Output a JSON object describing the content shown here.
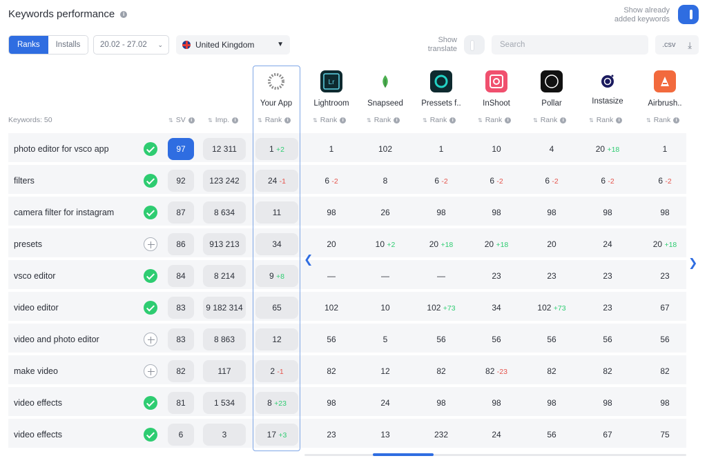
{
  "header": {
    "title": "Keywords performance",
    "show_added_label_1": "Show already",
    "show_added_label_2": "added keywords"
  },
  "toolbar": {
    "tabs": [
      "Ranks",
      "Installs"
    ],
    "active_tab": "Ranks",
    "date_range": "20.02 - 27.02",
    "country": "United Kingdom",
    "show_translate_1": "Show",
    "show_translate_2": "translate",
    "search_placeholder": "Search",
    "csv_label": ".csv"
  },
  "columns": {
    "keywords_label": "Keywords: 50",
    "sv_label": "SV",
    "imp_label": "Imp.",
    "rank_label": "Rank"
  },
  "apps": [
    {
      "name": "Your App",
      "icon": "your-app-icon",
      "color": "#ffffff"
    },
    {
      "name": "Lightroom",
      "icon": "lightroom-icon",
      "color": "#0e2a2f"
    },
    {
      "name": "Snapseed",
      "icon": "snapseed-icon",
      "color": "#ffffff"
    },
    {
      "name": "Pressets f..",
      "icon": "presets-icon",
      "color": "#0e2a2f"
    },
    {
      "name": "InShoot",
      "icon": "inshoot-icon",
      "color": "#f0506e"
    },
    {
      "name": "Pollar",
      "icon": "pollar-icon",
      "color": "#111111"
    },
    {
      "name": "Instasize",
      "icon": "instasize-icon",
      "color": "#ffffff"
    },
    {
      "name": "Airbrush..",
      "icon": "airbrush-icon",
      "color": "#f26a3d"
    }
  ],
  "rows": [
    {
      "keyword": "photo editor for vsco app",
      "added": true,
      "sv": "97",
      "sv_highlight": true,
      "imp": "12 311",
      "ranks": [
        [
          "1",
          "+2"
        ],
        [
          "1",
          ""
        ],
        [
          "102",
          ""
        ],
        [
          "1",
          ""
        ],
        [
          "10",
          ""
        ],
        [
          "4",
          ""
        ],
        [
          "20",
          "+18"
        ],
        [
          "1",
          ""
        ]
      ]
    },
    {
      "keyword": "filters",
      "added": true,
      "sv": "92",
      "imp": "123 242",
      "ranks": [
        [
          "24",
          "-1"
        ],
        [
          "6",
          "-2"
        ],
        [
          "8",
          ""
        ],
        [
          "6",
          "-2"
        ],
        [
          "6",
          "-2"
        ],
        [
          "6",
          "-2"
        ],
        [
          "6",
          "-2"
        ],
        [
          "6",
          "-2"
        ]
      ]
    },
    {
      "keyword": "camera filter for instagram",
      "added": true,
      "sv": "87",
      "imp": "8 634",
      "ranks": [
        [
          "11",
          ""
        ],
        [
          "98",
          ""
        ],
        [
          "26",
          ""
        ],
        [
          "98",
          ""
        ],
        [
          "98",
          ""
        ],
        [
          "98",
          ""
        ],
        [
          "98",
          ""
        ],
        [
          "98",
          ""
        ]
      ]
    },
    {
      "keyword": "presets",
      "added": false,
      "sv": "86",
      "imp": "913 213",
      "ranks": [
        [
          "34",
          ""
        ],
        [
          "20",
          ""
        ],
        [
          "10",
          "+2"
        ],
        [
          "20",
          "+18"
        ],
        [
          "20",
          "+18"
        ],
        [
          "20",
          ""
        ],
        [
          "24",
          ""
        ],
        [
          "20",
          "+18"
        ]
      ]
    },
    {
      "keyword": "vsco editor",
      "added": true,
      "sv": "84",
      "imp": "8 214",
      "ranks": [
        [
          "9",
          "+8"
        ],
        [
          "—",
          ""
        ],
        [
          "—",
          ""
        ],
        [
          "—",
          ""
        ],
        [
          "23",
          ""
        ],
        [
          "23",
          ""
        ],
        [
          "23",
          ""
        ],
        [
          "23",
          ""
        ]
      ]
    },
    {
      "keyword": "video editor",
      "added": true,
      "sv": "83",
      "imp": "9 182 314",
      "ranks": [
        [
          "65",
          ""
        ],
        [
          "102",
          ""
        ],
        [
          "10",
          ""
        ],
        [
          "102",
          "+73"
        ],
        [
          "34",
          ""
        ],
        [
          "102",
          "+73"
        ],
        [
          "23",
          ""
        ],
        [
          "67",
          ""
        ]
      ]
    },
    {
      "keyword": "video and photo editor",
      "added": false,
      "sv": "83",
      "imp": "8 863",
      "ranks": [
        [
          "12",
          ""
        ],
        [
          "56",
          ""
        ],
        [
          "5",
          ""
        ],
        [
          "56",
          ""
        ],
        [
          "56",
          ""
        ],
        [
          "56",
          ""
        ],
        [
          "56",
          ""
        ],
        [
          "56",
          ""
        ]
      ]
    },
    {
      "keyword": "make video",
      "added": false,
      "sv": "82",
      "imp": "117",
      "ranks": [
        [
          "2",
          "-1"
        ],
        [
          "82",
          ""
        ],
        [
          "12",
          ""
        ],
        [
          "82",
          ""
        ],
        [
          "82",
          "-23"
        ],
        [
          "82",
          ""
        ],
        [
          "82",
          ""
        ],
        [
          "82",
          ""
        ]
      ]
    },
    {
      "keyword": "video effects",
      "added": true,
      "sv": "81",
      "imp": "1 534",
      "ranks": [
        [
          "8",
          "+23"
        ],
        [
          "98",
          ""
        ],
        [
          "24",
          ""
        ],
        [
          "98",
          ""
        ],
        [
          "98",
          ""
        ],
        [
          "98",
          ""
        ],
        [
          "98",
          ""
        ],
        [
          "98",
          ""
        ]
      ]
    },
    {
      "keyword": "video effects",
      "added": true,
      "sv": "6",
      "imp": "3",
      "ranks": [
        [
          "17",
          "+3"
        ],
        [
          "23",
          ""
        ],
        [
          "13",
          ""
        ],
        [
          "232",
          ""
        ],
        [
          "24",
          ""
        ],
        [
          "56",
          ""
        ],
        [
          "67",
          ""
        ],
        [
          "75",
          ""
        ]
      ]
    }
  ],
  "colors": {
    "accent": "#2f6de1",
    "up": "#2ecc71",
    "down": "#e5534b"
  }
}
